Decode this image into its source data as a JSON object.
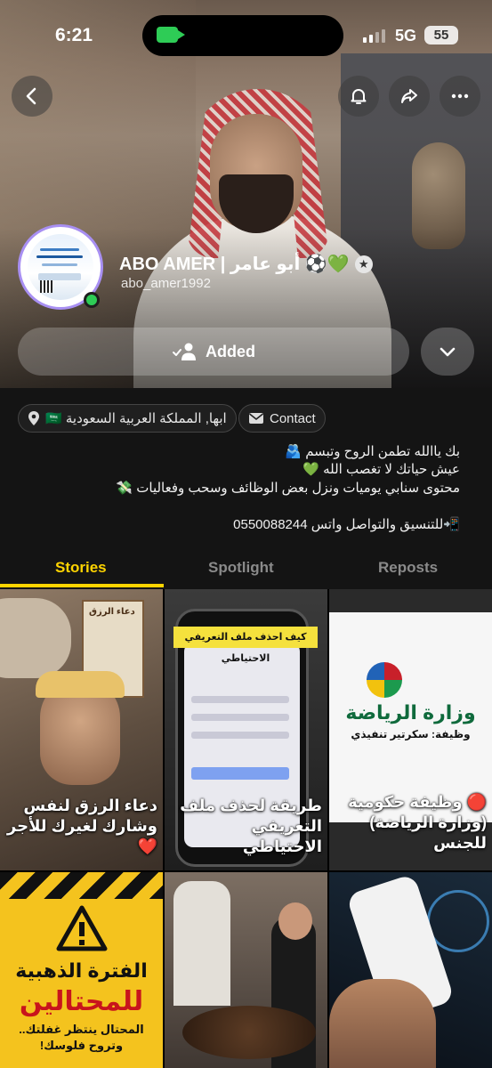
{
  "status_bar": {
    "time": "6:21",
    "network": "5G",
    "battery": "55"
  },
  "profile": {
    "display_name": "ABO AMER | أبو عامر ⚽️💚",
    "username": "abo_amer1992",
    "star_badge": "★"
  },
  "actions": {
    "added_label": "Added"
  },
  "chips": {
    "contact_label": "Contact",
    "location": "ابها, المملكة العربية السعودية 🇸🇦"
  },
  "bio_lines": [
    "بك ياالله تطمن الروح وتبسم 🫂",
    "عيش حياتك لا تغصب الله 💚",
    "محتوى سنابي يوميات ونزل بعض الوظائف وسحب وفعاليات 💸",
    "📲للتنسيق والتواصل واتس 0550088244"
  ],
  "tabs": [
    "Stories",
    "Spotlight",
    "Reposts"
  ],
  "active_tab": "Stories",
  "accent_color": "#ffd400",
  "stories": [
    {
      "caption": "دعاء الرزق لنفس وشارك لغيرك للأجر ❤️",
      "overlay": "دعاء الرزق"
    },
    {
      "caption": "طريقة لحذف ملف التعريفي الاحتياطي",
      "overlay": "كيف احذف ملف التعريفي الاحتياطي"
    },
    {
      "caption": "🔴 وظيفة حكومية (وزارة الرياضة) للجنس",
      "overlay_title": "وزارة الرياضة",
      "overlay_sub": "وظيفة: سكرتير تنفيذي"
    },
    {
      "caption": "",
      "overlay_1": "الفترة الذهبية",
      "overlay_2": "للمحتالين",
      "overlay_3": "المحتال ينتظر غفلتك.. وتروح فلوسك!"
    },
    {
      "caption": ""
    },
    {
      "caption": ""
    }
  ]
}
